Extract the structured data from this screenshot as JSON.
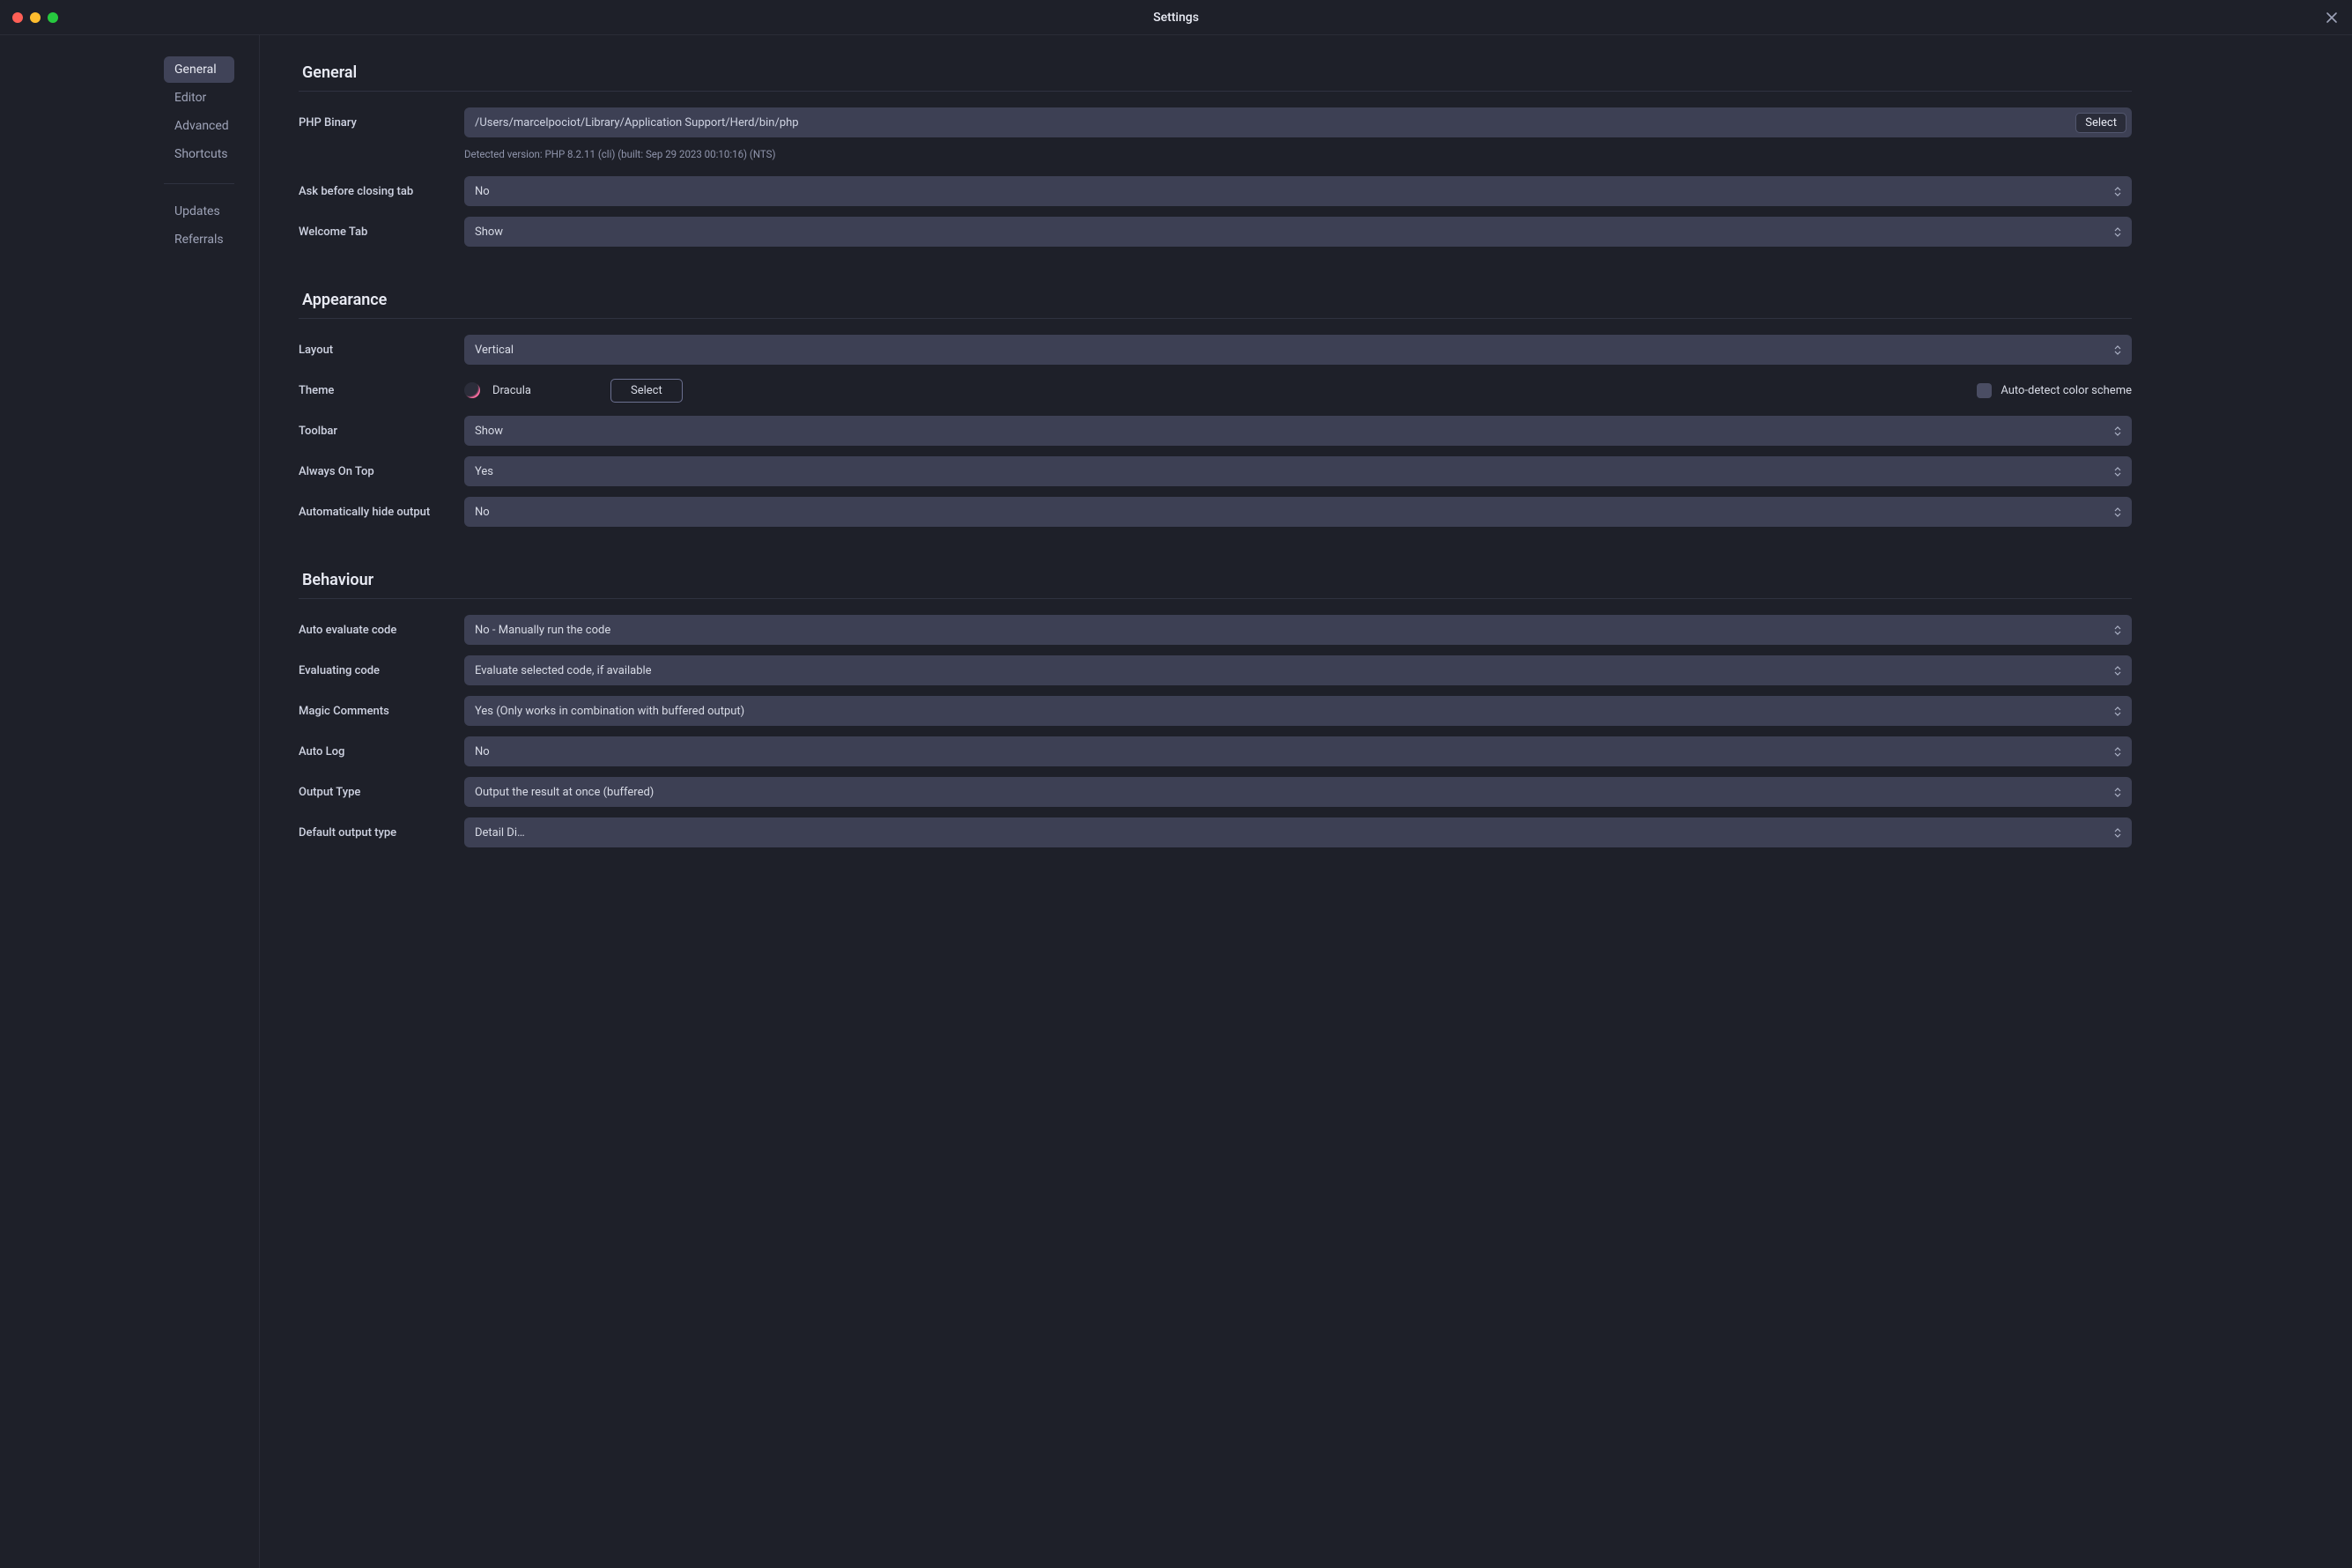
{
  "window": {
    "title": "Settings"
  },
  "sidebar": {
    "items": [
      {
        "label": "General",
        "active": true
      },
      {
        "label": "Editor",
        "active": false
      },
      {
        "label": "Advanced",
        "active": false
      },
      {
        "label": "Shortcuts",
        "active": false
      }
    ],
    "secondary": [
      {
        "label": "Updates"
      },
      {
        "label": "Referrals"
      }
    ]
  },
  "sections": {
    "general": {
      "title": "General",
      "php_binary": {
        "label": "PHP Binary",
        "value": "/Users/marcelpociot/Library/Application Support/Herd/bin/php",
        "select_button": "Select",
        "detected": "Detected version: PHP 8.2.11 (cli) (built: Sep 29 2023 00:10:16) (NTS)"
      },
      "ask_before_closing": {
        "label": "Ask before closing tab",
        "value": "No"
      },
      "welcome_tab": {
        "label": "Welcome Tab",
        "value": "Show"
      }
    },
    "appearance": {
      "title": "Appearance",
      "layout": {
        "label": "Layout",
        "value": "Vertical"
      },
      "theme": {
        "label": "Theme",
        "name": "Dracula",
        "select_button": "Select",
        "auto_detect_label": "Auto-detect color scheme",
        "auto_detect_checked": false
      },
      "toolbar": {
        "label": "Toolbar",
        "value": "Show"
      },
      "always_on_top": {
        "label": "Always On Top",
        "value": "Yes"
      },
      "auto_hide_output": {
        "label": "Automatically hide output",
        "value": "No"
      }
    },
    "behaviour": {
      "title": "Behaviour",
      "auto_evaluate": {
        "label": "Auto evaluate code",
        "value": "No - Manually run the code"
      },
      "evaluating_code": {
        "label": "Evaluating code",
        "value": "Evaluate selected code, if available"
      },
      "magic_comments": {
        "label": "Magic Comments",
        "value": "Yes (Only works in combination with buffered output)"
      },
      "auto_log": {
        "label": "Auto Log",
        "value": "No"
      },
      "output_type": {
        "label": "Output Type",
        "value": "Output the result at once (buffered)"
      },
      "default_output": {
        "label": "Default output type",
        "value": "Detail Di…"
      }
    }
  }
}
